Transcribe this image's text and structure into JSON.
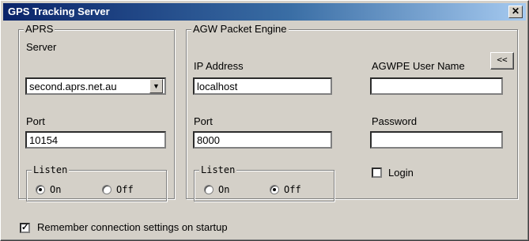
{
  "window": {
    "title": "GPS Tracking Server",
    "close_glyph": "✕"
  },
  "aprs": {
    "group_label": "APRS",
    "server_label": "Server",
    "server_value": "second.aprs.net.au",
    "dropdown_glyph": "▼",
    "port_label": "Port",
    "port_value": "10154",
    "listen": {
      "label": "Listen",
      "on_label": "On",
      "off_label": "Off",
      "selected": "On"
    }
  },
  "agw": {
    "group_label": "AGW Packet Engine",
    "ip_label": "IP Address",
    "ip_value": "localhost",
    "port_label": "Port",
    "port_value": "8000",
    "user_label": "AGWPE User Name",
    "user_value": "",
    "password_label": "Password",
    "password_value": "",
    "login_label": "Login",
    "login_checked": false,
    "collapse_label": "<<",
    "listen": {
      "label": "Listen",
      "on_label": "On",
      "off_label": "Off",
      "selected": "Off"
    }
  },
  "footer": {
    "remember_label": "Remember connection settings on startup",
    "remember_checked": true,
    "check_glyph": "✓"
  }
}
